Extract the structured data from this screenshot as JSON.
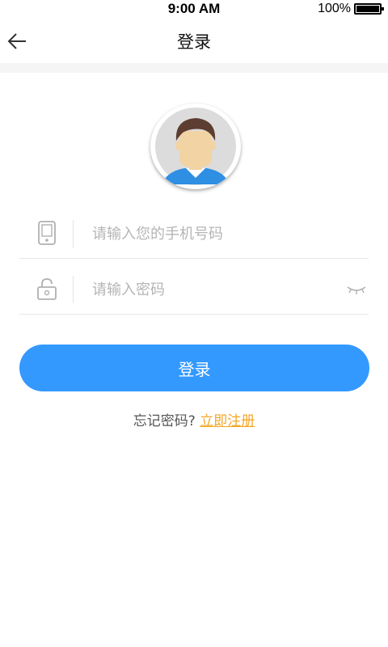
{
  "status_bar": {
    "time": "9:00 AM",
    "battery": "100%"
  },
  "nav": {
    "title": "登录"
  },
  "form": {
    "phone_placeholder": "请输入您的手机号码",
    "password_placeholder": "请输入密码",
    "login_label": "登录"
  },
  "links": {
    "forgot": "忘记密码?",
    "register": "立即注册"
  },
  "colors": {
    "accent": "#3399ff",
    "link": "#f5a623"
  },
  "icons": [
    "back-arrow-icon",
    "avatar-icon",
    "phone-icon",
    "lock-icon",
    "eye-closed-icon",
    "battery-icon"
  ]
}
